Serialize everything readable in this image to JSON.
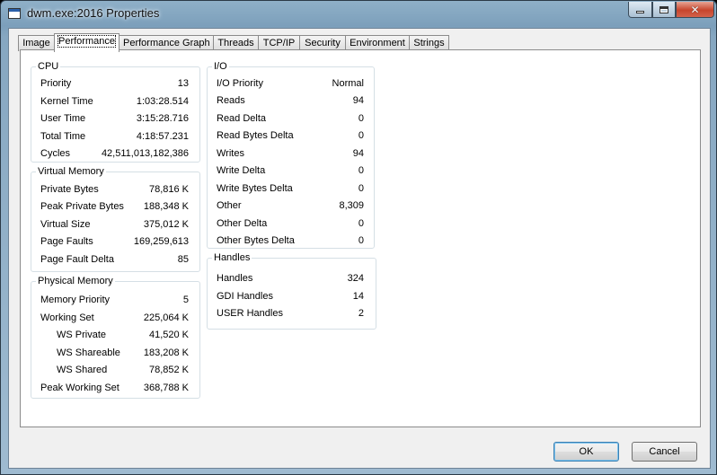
{
  "window": {
    "title": "dwm.exe:2016 Properties"
  },
  "tabs": [
    {
      "label": "Image"
    },
    {
      "label": "Performance"
    },
    {
      "label": "Performance Graph"
    },
    {
      "label": "Threads"
    },
    {
      "label": "TCP/IP"
    },
    {
      "label": "Security"
    },
    {
      "label": "Environment"
    },
    {
      "label": "Strings"
    }
  ],
  "active_tab": "Performance",
  "cpu": {
    "title": "CPU",
    "rows": [
      {
        "label": "Priority",
        "value": "13"
      },
      {
        "label": "Kernel Time",
        "value": "1:03:28.514"
      },
      {
        "label": "User Time",
        "value": "3:15:28.716"
      },
      {
        "label": "Total Time",
        "value": "4:18:57.231"
      },
      {
        "label": "Cycles",
        "value": "42,511,013,182,386"
      }
    ]
  },
  "virtual_memory": {
    "title": "Virtual Memory",
    "rows": [
      {
        "label": "Private Bytes",
        "value": "78,816 K"
      },
      {
        "label": "Peak Private Bytes",
        "value": "188,348 K"
      },
      {
        "label": "Virtual Size",
        "value": "375,012 K"
      },
      {
        "label": "Page Faults",
        "value": "169,259,613"
      },
      {
        "label": "Page Fault Delta",
        "value": "85"
      }
    ]
  },
  "physical_memory": {
    "title": "Physical Memory",
    "rows": [
      {
        "label": "Memory Priority",
        "value": "5"
      },
      {
        "label": "Working Set",
        "value": "225,064 K"
      },
      {
        "label": "WS Private",
        "value": "41,520 K"
      },
      {
        "label": "WS Shareable",
        "value": "183,208 K"
      },
      {
        "label": "WS Shared",
        "value": "78,852 K"
      },
      {
        "label": "Peak Working Set",
        "value": "368,788 K"
      }
    ]
  },
  "io": {
    "title": "I/O",
    "rows": [
      {
        "label": "I/O Priority",
        "value": "Normal"
      },
      {
        "label": "Reads",
        "value": "94"
      },
      {
        "label": "Read Delta",
        "value": "0"
      },
      {
        "label": "Read Bytes Delta",
        "value": "0"
      },
      {
        "label": "Writes",
        "value": "94"
      },
      {
        "label": "Write Delta",
        "value": "0"
      },
      {
        "label": "Write Bytes Delta",
        "value": "0"
      },
      {
        "label": "Other",
        "value": "8,309"
      },
      {
        "label": "Other Delta",
        "value": "0"
      },
      {
        "label": "Other Bytes Delta",
        "value": "0"
      }
    ]
  },
  "handles": {
    "title": "Handles",
    "rows": [
      {
        "label": "Handles",
        "value": "324"
      },
      {
        "label": "GDI Handles",
        "value": "14"
      },
      {
        "label": "USER Handles",
        "value": "2"
      }
    ]
  },
  "buttons": {
    "ok": "OK",
    "cancel": "Cancel"
  },
  "icons": {
    "app": "properties-window-icon",
    "minimize": "minimize-icon",
    "maximize": "maximize-icon",
    "close": "close-icon"
  },
  "colors": {
    "close_button": "#c7452d",
    "default_button_border": "#3c7fb1"
  }
}
